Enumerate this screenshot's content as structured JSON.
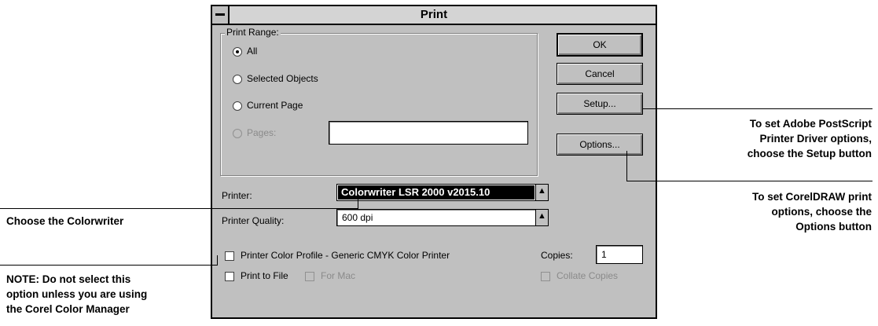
{
  "dialog": {
    "title": "Print",
    "print_range": {
      "label": "Print Range:",
      "options": [
        {
          "label": "All",
          "selected": true,
          "enabled": true
        },
        {
          "label": "Selected Objects",
          "selected": false,
          "enabled": true
        },
        {
          "label": "Current Page",
          "selected": false,
          "enabled": true
        },
        {
          "label": "Pages:",
          "selected": false,
          "enabled": false
        }
      ],
      "pages_value": ""
    },
    "buttons": {
      "ok": "OK",
      "cancel": "Cancel",
      "setup": "Setup...",
      "options": "Options..."
    },
    "printer": {
      "label": "Printer:",
      "value": "Colorwriter LSR 2000 v2015.10"
    },
    "printer_quality": {
      "label": "Printer Quality:",
      "value": "600 dpi"
    },
    "checkboxes": {
      "color_profile": "Printer Color Profile - Generic CMYK Color Printer",
      "print_to_file": "Print to File",
      "for_mac": "For Mac",
      "collate": "Collate Copies"
    },
    "copies": {
      "label": "Copies:",
      "value": "1"
    }
  },
  "callouts": {
    "choose_colorwriter": "Choose the Colorwriter",
    "note": [
      "NOTE: Do not select this",
      "option unless you are using",
      "the Corel Color Manager"
    ],
    "setup": [
      "To set Adobe PostScript",
      "Printer Driver options,",
      "choose the Setup button"
    ],
    "options": [
      "To set CorelDRAW print",
      "options, choose the",
      "Options button"
    ]
  }
}
